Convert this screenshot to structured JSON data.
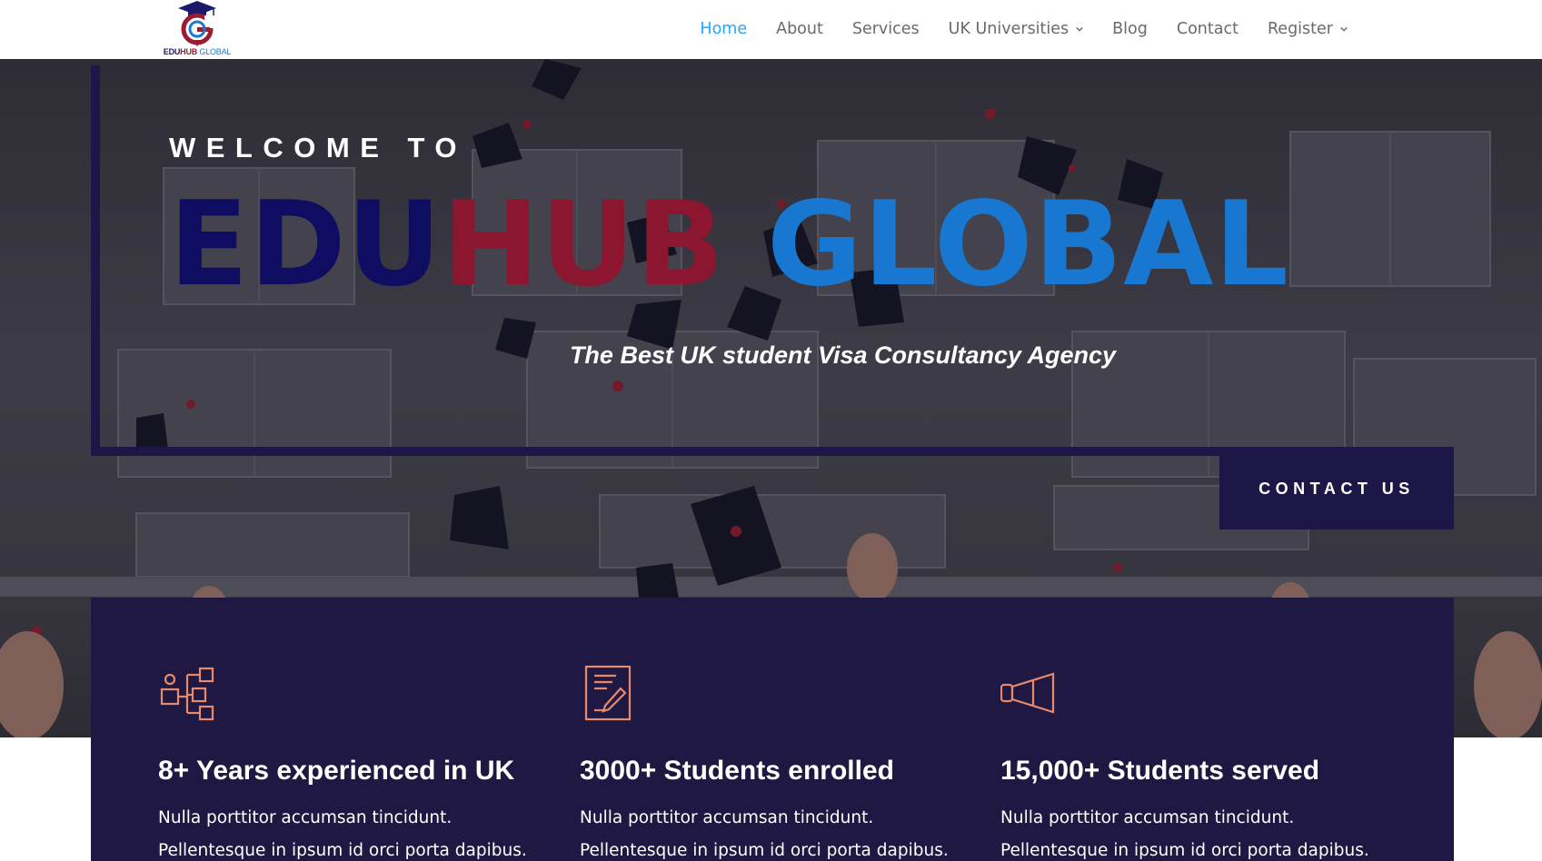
{
  "header": {
    "logo": {
      "part1": "EDU",
      "part2": "HUB",
      "part3": "GLOBAL"
    },
    "nav": [
      {
        "label": "Home",
        "active": true,
        "has_dropdown": false
      },
      {
        "label": "About",
        "active": false,
        "has_dropdown": false
      },
      {
        "label": "Services",
        "active": false,
        "has_dropdown": false
      },
      {
        "label": "UK Universities",
        "active": false,
        "has_dropdown": true
      },
      {
        "label": "Blog",
        "active": false,
        "has_dropdown": false
      },
      {
        "label": "Contact",
        "active": false,
        "has_dropdown": false
      },
      {
        "label": "Register",
        "active": false,
        "has_dropdown": true
      }
    ]
  },
  "hero": {
    "welcome": "WELCOME TO",
    "brand_part1": "EDU",
    "brand_part2": "HUB",
    "brand_part3": "GLOBAL",
    "tagline": "The Best UK student Visa Consultancy Agency",
    "contact_button": "CONTACT US"
  },
  "features": [
    {
      "icon": "network-nodes-icon",
      "title": "8+ Years experienced in UK",
      "text": "Nulla porttitor accumsan tincidunt.",
      "text2": "Pellentesque in ipsum id orci porta dapibus."
    },
    {
      "icon": "document-pen-icon",
      "title": "3000+ Students enrolled",
      "text": "Nulla porttitor accumsan tincidunt.",
      "text2": "Pellentesque in ipsum id orci porta dapibus."
    },
    {
      "icon": "megaphone-icon",
      "title": "15,000+ Students served",
      "text": "Nulla porttitor accumsan tincidunt.",
      "text2": "Pellentesque in ipsum id orci porta dapibus."
    }
  ],
  "colors": {
    "nav_active": "#2ea3f2",
    "brand_navy": "#0f0d62",
    "brand_red": "#8c1530",
    "brand_blue": "#1877d0",
    "panel": "#1f1842",
    "icon_accent": "#e8896b"
  }
}
